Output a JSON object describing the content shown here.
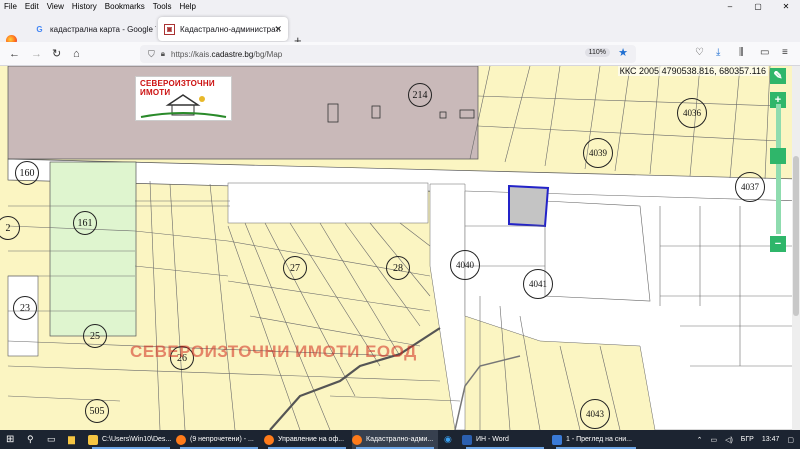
{
  "menu": [
    "File",
    "Edit",
    "View",
    "History",
    "Bookmarks",
    "Tools",
    "Help"
  ],
  "window_controls": [
    "–",
    "▢",
    "✕"
  ],
  "tabs": [
    {
      "label": "кадастрална карта - Google Търсене",
      "icon": "google-icon"
    },
    {
      "label": "Кадастрално-административна информационна система",
      "icon": "cadastre-icon"
    }
  ],
  "new_tab": "+",
  "nav": {
    "back": "←",
    "forward": "→",
    "reload": "↻",
    "home": "⌂"
  },
  "url": {
    "prefix": "https://kais.",
    "domain": "cadastre.bg",
    "path": "/bg/Map"
  },
  "zoom_level": "110%",
  "map": {
    "logo_text": "СЕВЕРОИЗТОЧНИ ИМОТИ",
    "coords": "ККС 2005 4790538.816, 680357.116",
    "watermark": "СЕВЕРОИЗТОЧНИ ИМОТИ ЕООД",
    "zoom_in": "+",
    "zoom_out": "−",
    "parcel_labels": [
      "214",
      "4036",
      "4039",
      "4037",
      "160",
      "161",
      "2",
      "27",
      "28",
      "4040",
      "4041",
      "23",
      "25",
      "26",
      "505",
      "4043"
    ],
    "colors": {
      "parcel": "#fbf5c2",
      "urban": "#c9b9b9",
      "meadow": "#dff5cf",
      "selected": "#2323c8",
      "selected_fill": "#c4c4c4",
      "road": "#ffffff",
      "line": "#555555"
    }
  },
  "taskbar": {
    "items": [
      {
        "label": "C:\\Users\\Win10\\Des...",
        "icon": "folder-icon"
      },
      {
        "label": "(9 непрочетени) - ...",
        "icon": "firefox-icon"
      },
      {
        "label": "Управление на оф...",
        "icon": "firefox-icon"
      },
      {
        "label": "Кадастрално-адми...",
        "icon": "firefox-icon"
      },
      {
        "label": "ИН - Word",
        "icon": "word-icon"
      },
      {
        "label": "1 - Преглед на сни...",
        "icon": "photos-icon"
      }
    ],
    "lang": "БГР",
    "time": "13:47"
  }
}
